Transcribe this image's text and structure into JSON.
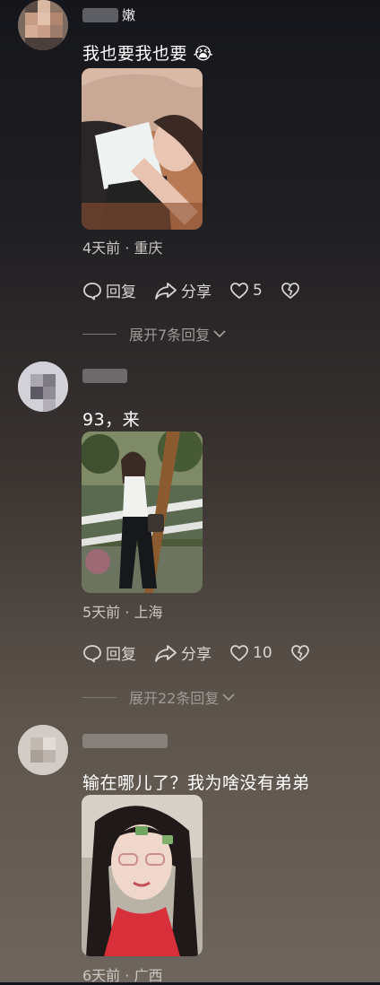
{
  "comments": [
    {
      "username_visible": "嫩",
      "text": "我也要我也要 😭",
      "meta": "4天前 · 重庆",
      "actions": {
        "reply": "回复",
        "share": "分享",
        "likes": "5"
      },
      "expand": "展开7条回复"
    },
    {
      "username_visible": "",
      "text": "93，来",
      "meta": "5天前 · 上海",
      "actions": {
        "reply": "回复",
        "share": "分享",
        "likes": "10"
      },
      "expand": "展开22条回复"
    },
    {
      "username_visible": "",
      "text": "输在哪儿了？我为啥没有弟弟",
      "meta": "6天前 · 广西",
      "actions": {
        "reply": "回复",
        "share": "分享",
        "likes": ""
      },
      "expand": ""
    }
  ],
  "colors": {
    "text": "#ffffff",
    "meta": "#c9c6c2",
    "muted": "#9e9a96"
  }
}
